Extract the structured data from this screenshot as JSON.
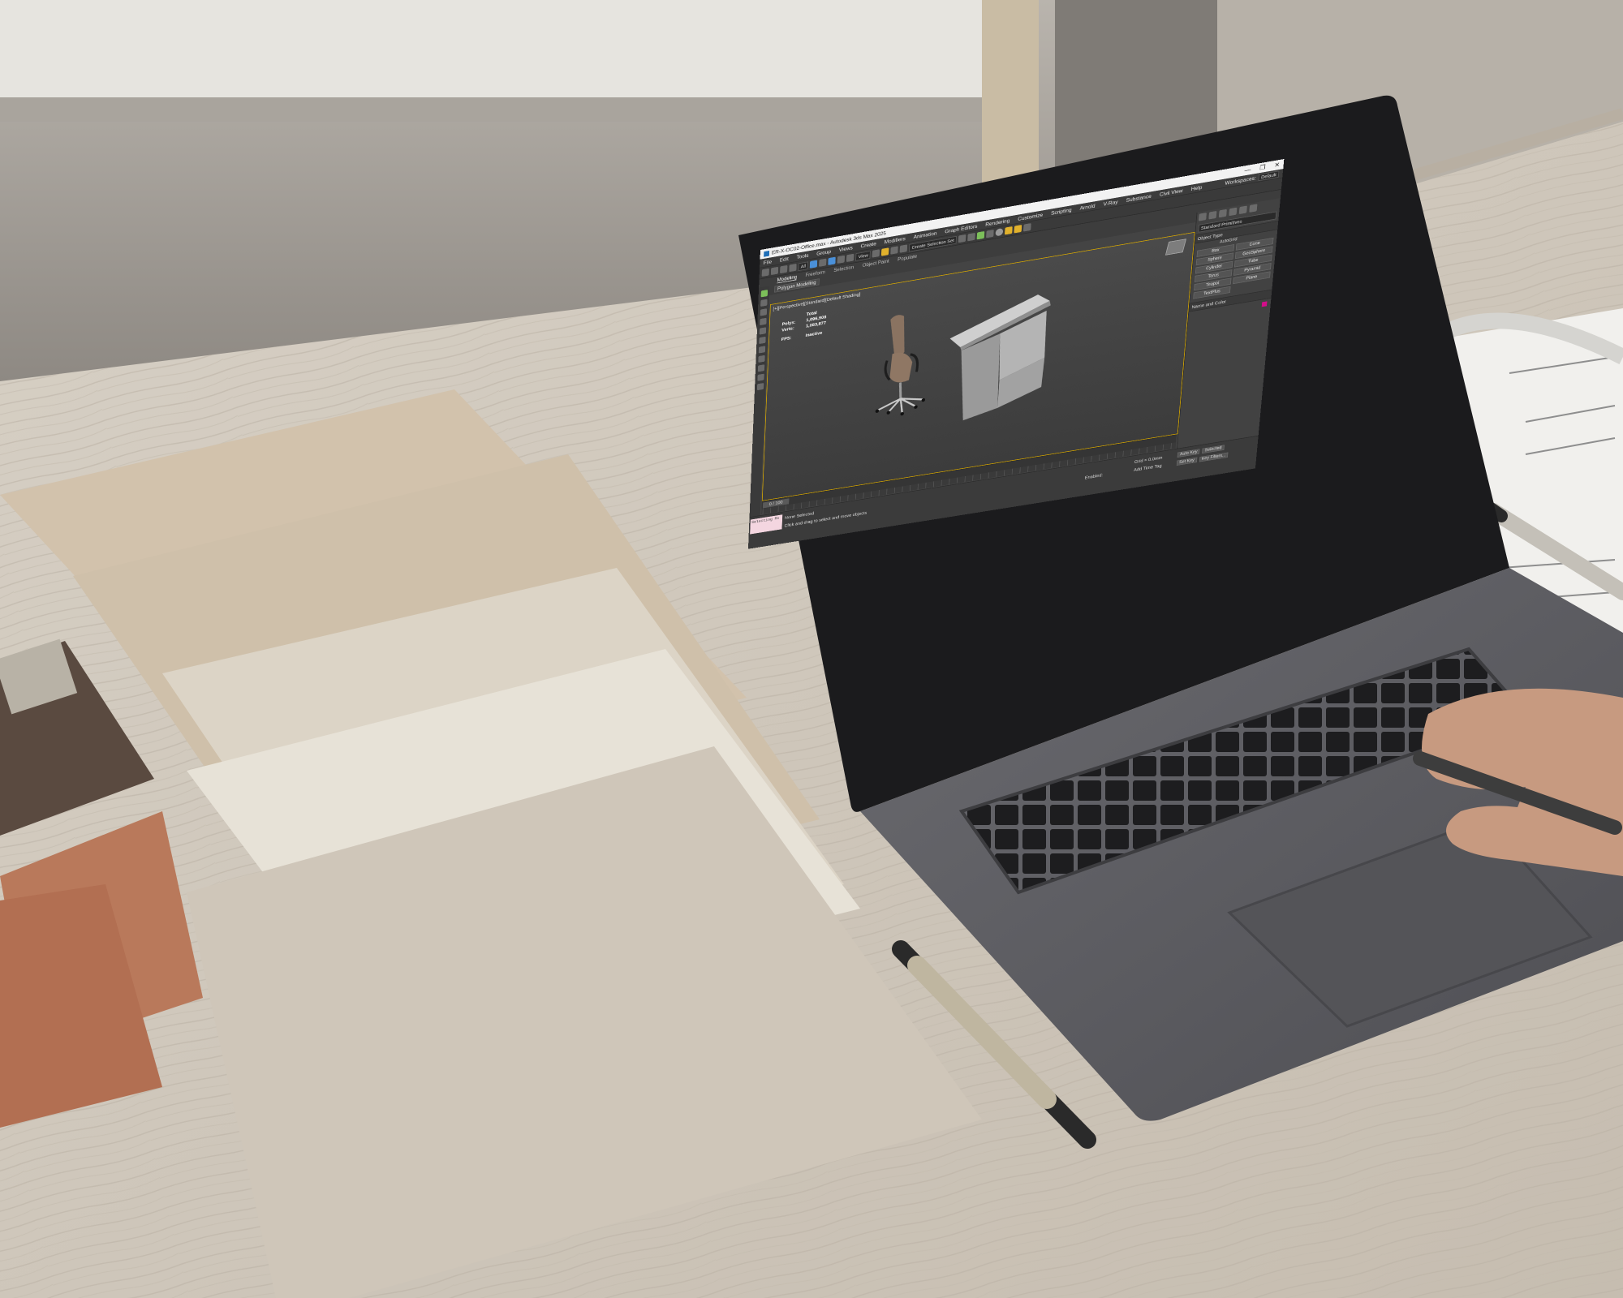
{
  "window": {
    "title": "ER-X-OC02-Office.max - Autodesk 3ds Max 2025",
    "controls": [
      "—",
      "❐",
      "✕"
    ]
  },
  "menu": {
    "items": [
      "File",
      "Edit",
      "Tools",
      "Group",
      "Views",
      "Create",
      "Modifiers",
      "Animation",
      "Graph Editors",
      "Rendering",
      "Customize",
      "Scripting",
      "Arnold",
      "V-Ray",
      "Substance",
      "Civil View",
      "Help"
    ],
    "workspace_label": "Workspaces:",
    "workspace_value": "Default"
  },
  "toolbar": {
    "filter_value": "All",
    "view_value": "View",
    "selection_set": "Create Selection Set"
  },
  "ribbon": {
    "tabs": [
      "Modeling",
      "Freeform",
      "Selection",
      "Object Paint",
      "Populate"
    ],
    "active_tab": "Modeling",
    "sub_label": "Polygon Modeling"
  },
  "viewport": {
    "label": "[+][Perspective][Standard][Default Shading]",
    "stats_header": "Total",
    "stats": [
      {
        "key": "Polys:",
        "value": "1,096,908"
      },
      {
        "key": "Verts:",
        "value": "1,083,877"
      }
    ],
    "fps_key": "FPS:",
    "fps_value": "Inactive"
  },
  "command_panel": {
    "dropdown": "Standard Primitives",
    "object_type_header": "Object Type",
    "autogrid": "AutoGrid",
    "buttons": [
      "Box",
      "Cone",
      "Sphere",
      "GeoSphere",
      "Cylinder",
      "Tube",
      "Torus",
      "Pyramid",
      "Teapot",
      "Plane",
      "TextPlus"
    ],
    "name_color_header": "Name and Color",
    "color": "#d40d8a"
  },
  "timeline": {
    "slider": "0 / 100"
  },
  "status": {
    "listener": "Selecting Mo",
    "line1": "None Selected",
    "line2": "Click and drag to select and move objects",
    "grid": "Grid = 0.0mm",
    "add_time_tag": "Add Time Tag",
    "enabled": "Enabled:",
    "autokey": "Auto Key",
    "selected": "Selected",
    "setkey": "Set Key",
    "key_filters": "Key Filters..."
  },
  "colors": {
    "wood": "#cdc5b8",
    "wall": "#9c9690",
    "laptop_body": "#5d5d62",
    "viewport_border": "#d9a900",
    "leather_terracotta": "#b9795b"
  }
}
